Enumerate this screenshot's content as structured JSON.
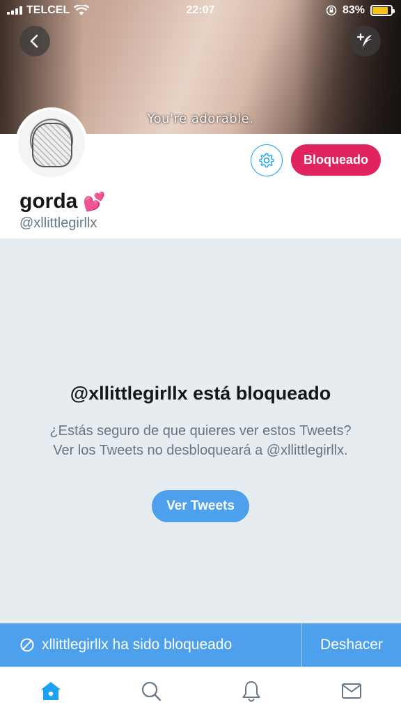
{
  "status_bar": {
    "carrier": "TELCEL",
    "time": "22:07",
    "battery": "83%",
    "battery_level": 0.83
  },
  "header": {
    "banner_caption": "You're adorable."
  },
  "profile": {
    "display_name": "gorda",
    "display_emoji": "💕",
    "handle": "@xllittlegirllx",
    "blocked_label": "Bloqueado"
  },
  "blocked_notice": {
    "title": "@xllittlegirllx está bloqueado",
    "description": "¿Estás seguro de que quieres ver estos Tweets? Ver los Tweets no desbloqueará a @xllittlegirllx.",
    "view_button": "Ver Tweets"
  },
  "snackbar": {
    "message": "xllittlegirllx ha sido bloqueado",
    "undo": "Deshacer"
  },
  "tabbar": {
    "items": [
      "home-icon",
      "search-icon",
      "bell-icon",
      "mail-icon"
    ]
  },
  "colors": {
    "accent": "#1da1f2",
    "blocked": "#e0245e",
    "snackbar": "#4ca0ec",
    "background": "#e6ecf0"
  }
}
